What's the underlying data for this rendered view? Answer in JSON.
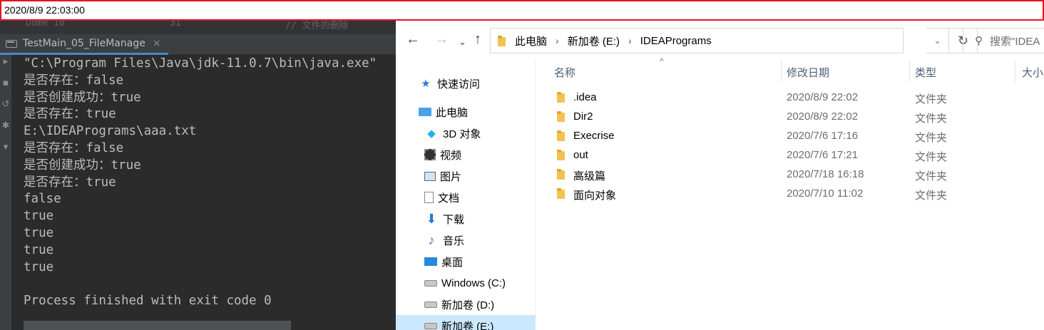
{
  "timestamp": "2020/8/9 22:03:00",
  "ide": {
    "top_strip_ghost": [
      "Dome 10",
      "31",
      "// 文件的删除"
    ],
    "run_tab_label": "TestMain_05_FileManage",
    "run_tab_close": "×",
    "console_lines": [
      "\"C:\\Program Files\\Java\\jdk-11.0.7\\bin\\java.exe\"",
      "是否存在：false",
      "是否创建成功：true",
      "是否存在：true",
      "E:\\IDEAPrograms\\aaa.txt",
      "是否存在：false",
      "是否创建成功：true",
      "是否存在：true",
      "false",
      "true",
      "true",
      "true",
      "true",
      "",
      "Process finished with exit code 0"
    ]
  },
  "explorer": {
    "breadcrumbs": [
      "此电脑",
      "新加卷 (E:)",
      "IDEAPrograms"
    ],
    "search_placeholder": "搜索\"IDEA",
    "nav_items": [
      {
        "label": "快速访问",
        "icon": "star-icon"
      },
      {
        "label": "此电脑",
        "icon": "computer-icon"
      },
      {
        "label": "3D 对象",
        "icon": "cube-icon"
      },
      {
        "label": "视频",
        "icon": "video-icon"
      },
      {
        "label": "图片",
        "icon": "picture-icon"
      },
      {
        "label": "文档",
        "icon": "document-icon"
      },
      {
        "label": "下载",
        "icon": "download-icon"
      },
      {
        "label": "音乐",
        "icon": "music-icon"
      },
      {
        "label": "桌面",
        "icon": "desktop-icon"
      },
      {
        "label": "Windows (C:)",
        "icon": "drive-c-icon"
      },
      {
        "label": "新加卷 (D:)",
        "icon": "drive-d-icon"
      },
      {
        "label": "新加卷 (E:)",
        "icon": "drive-e-icon"
      }
    ],
    "columns": {
      "name": "名称",
      "modified": "修改日期",
      "type": "类型",
      "size": "大小"
    },
    "files": [
      {
        "name": ".idea",
        "date": "2020/8/9 22:02",
        "type": "文件夹"
      },
      {
        "name": "Dir2",
        "date": "2020/8/9 22:02",
        "type": "文件夹"
      },
      {
        "name": "Execrise",
        "date": "2020/7/6 17:16",
        "type": "文件夹"
      },
      {
        "name": "out",
        "date": "2020/7/6 17:21",
        "type": "文件夹"
      },
      {
        "name": "高级篇",
        "date": "2020/7/18 16:18",
        "type": "文件夹"
      },
      {
        "name": "面向对象",
        "date": "2020/7/10 11:02",
        "type": "文件夹"
      }
    ],
    "colors": {
      "selected_bg": "#cce8ff",
      "header_text": "#4c607a",
      "folder": "#f3c34f",
      "ide_bg": "#2b2b2b"
    }
  }
}
